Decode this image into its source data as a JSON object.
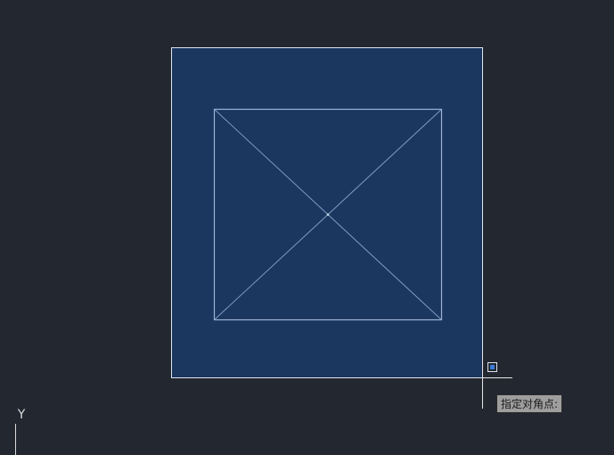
{
  "canvas": {
    "background_color": "#222730",
    "selection_fill_color": "#1b365f",
    "line_color": "#8fa8cc",
    "crosshair_color": "#ffffff",
    "osnap_marker_color": "#3a7bd5"
  },
  "command_prompt": {
    "text": "指定对角点:"
  },
  "ucs_icon": {
    "axis_label": "Y"
  }
}
